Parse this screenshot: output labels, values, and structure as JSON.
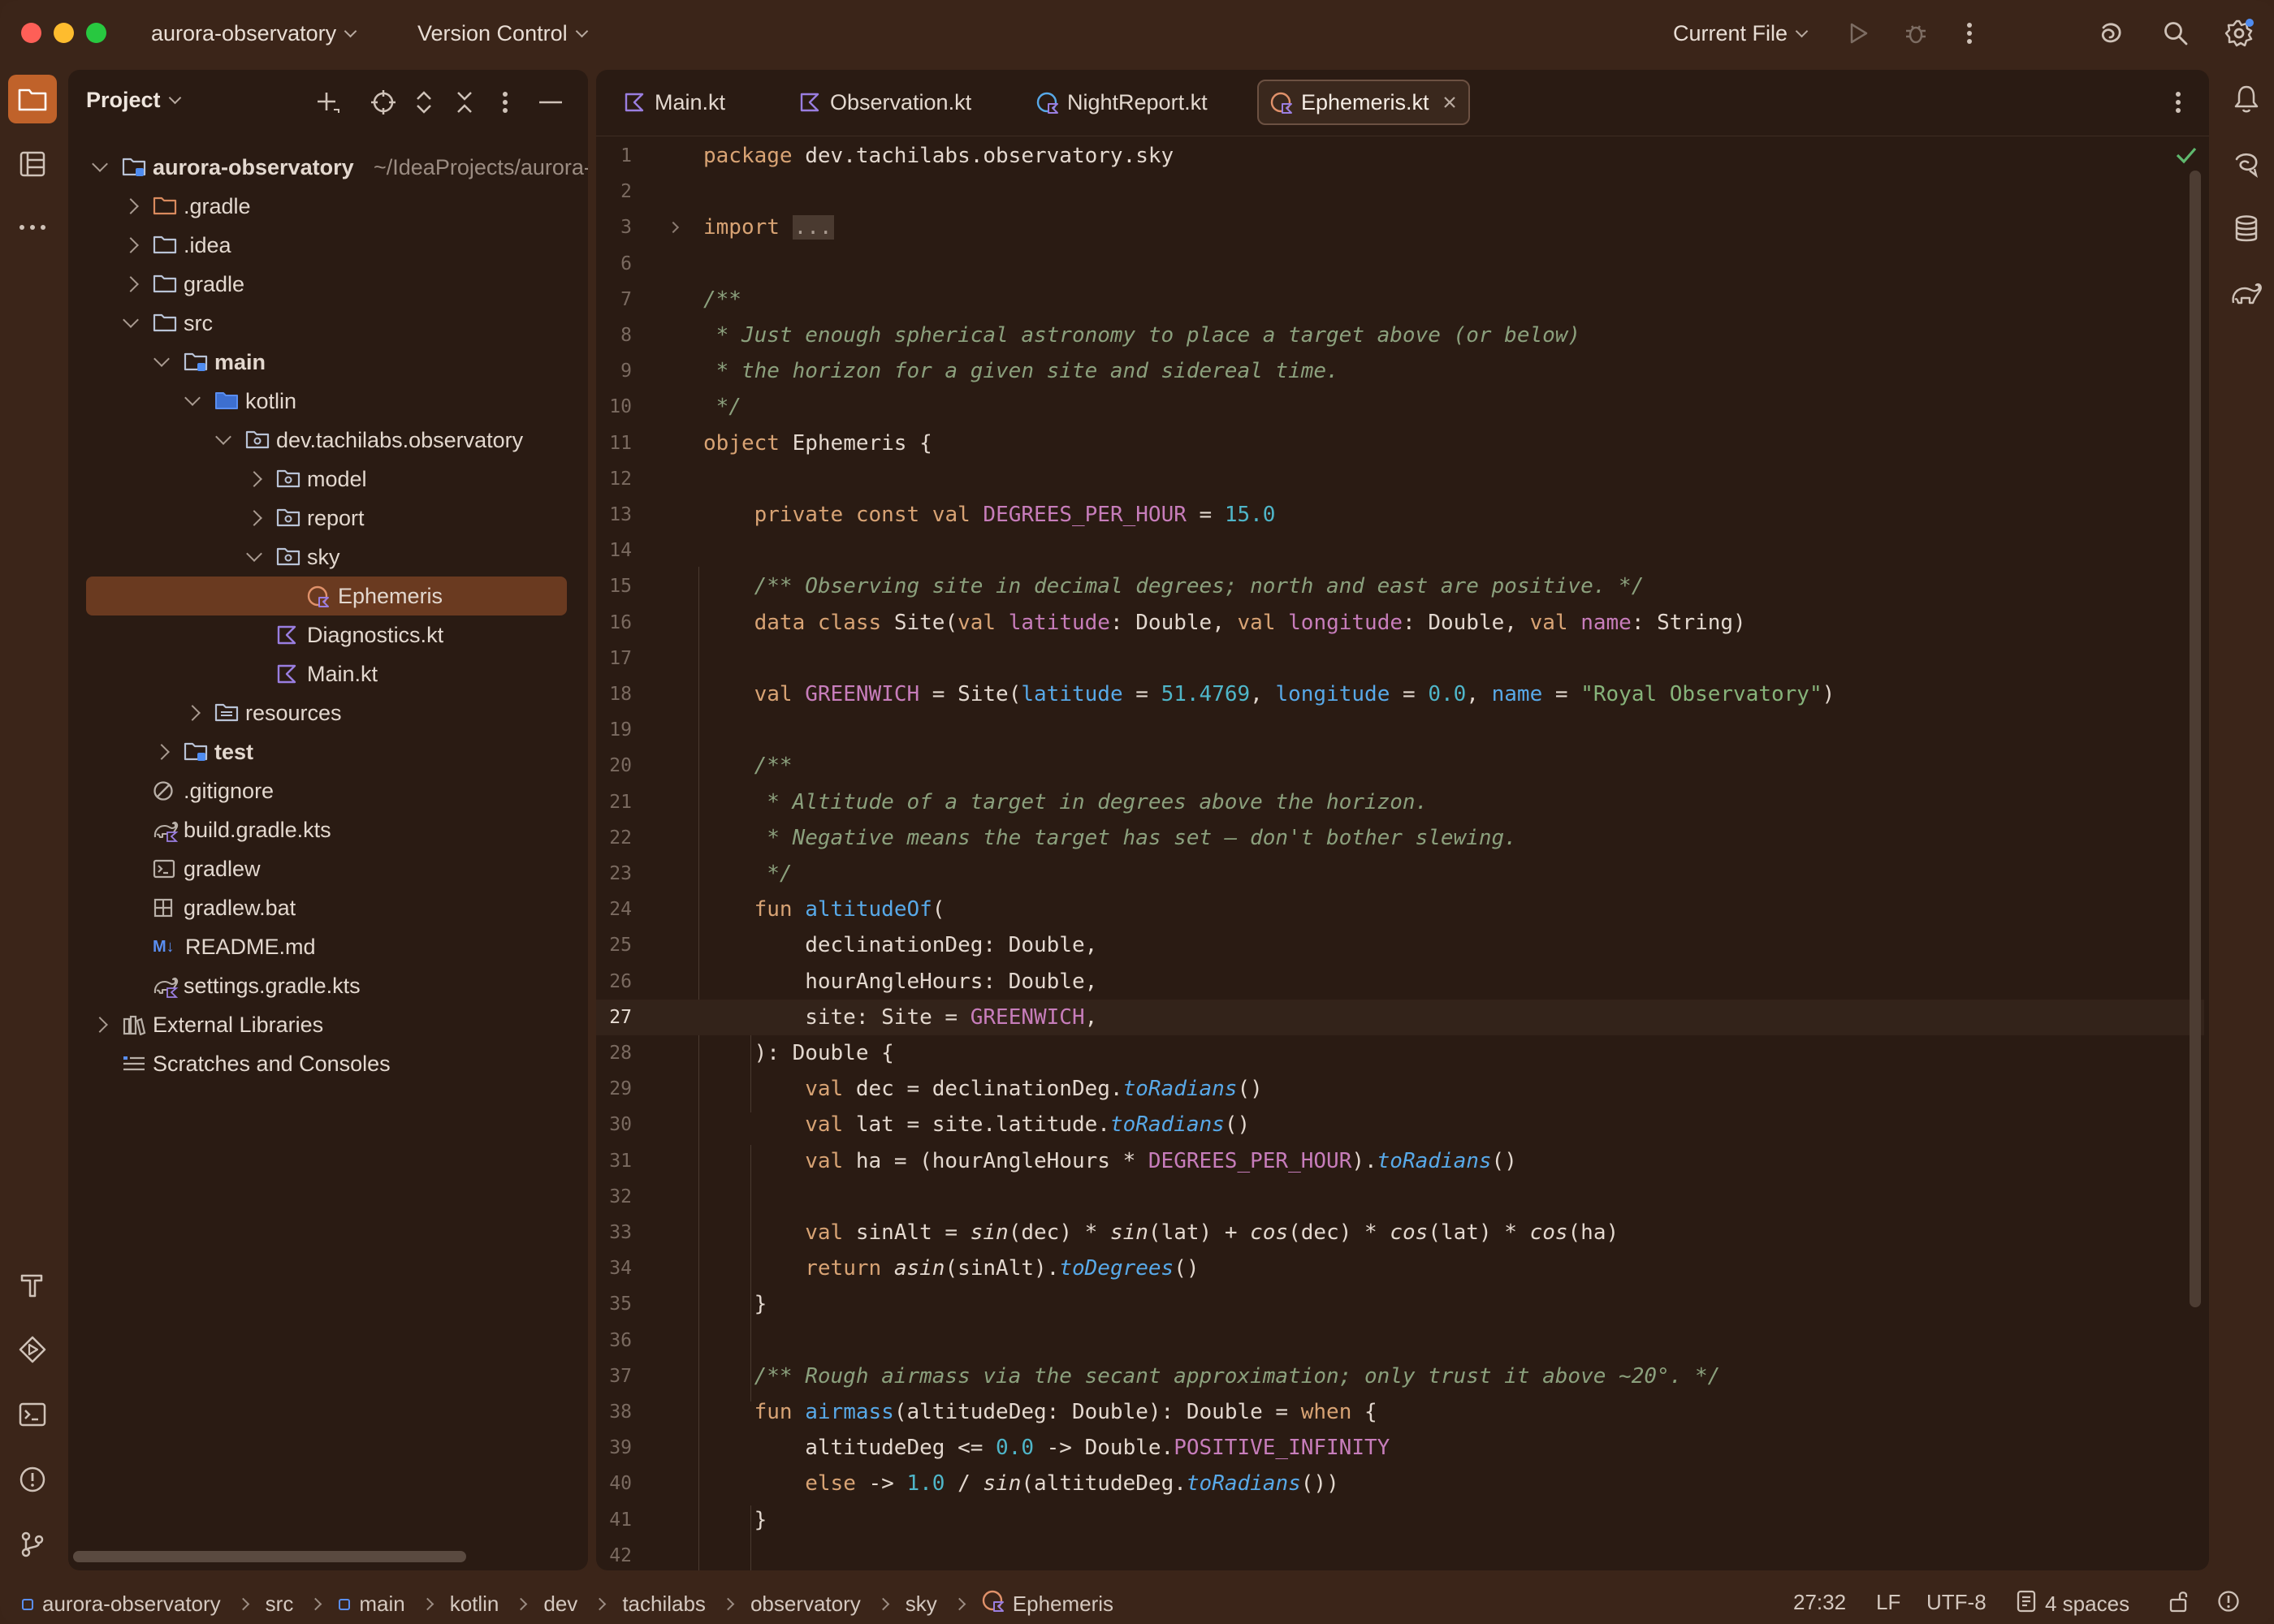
{
  "titlebar": {
    "project_name": "aurora-observatory",
    "vcs_label": "Version Control",
    "run_config": "Current File"
  },
  "project_panel": {
    "title": "Project",
    "tree": [
      {
        "label": "aurora-observatory",
        "hint": "~/IdeaProjects/aurora-",
        "icon": "module-folder-icon",
        "depth": 0,
        "expanded": true,
        "bold": true
      },
      {
        "label": ".gradle",
        "icon": "folder-orange-icon",
        "depth": 1,
        "expanded": false
      },
      {
        "label": ".idea",
        "icon": "folder-icon",
        "depth": 1,
        "expanded": false
      },
      {
        "label": "gradle",
        "icon": "folder-icon",
        "depth": 1,
        "expanded": false
      },
      {
        "label": "src",
        "icon": "folder-icon",
        "depth": 1,
        "expanded": true
      },
      {
        "label": "main",
        "icon": "source-set-folder-icon",
        "depth": 2,
        "expanded": true,
        "bold": true
      },
      {
        "label": "kotlin",
        "icon": "source-root-folder-icon",
        "depth": 3,
        "expanded": true
      },
      {
        "label": "dev.tachilabs.observatory",
        "icon": "package-icon",
        "depth": 4,
        "expanded": true
      },
      {
        "label": "model",
        "icon": "package-icon",
        "depth": 5,
        "expanded": false
      },
      {
        "label": "report",
        "icon": "package-icon",
        "depth": 5,
        "expanded": false
      },
      {
        "label": "sky",
        "icon": "package-icon",
        "depth": 5,
        "expanded": true
      },
      {
        "label": "Ephemeris",
        "icon": "kotlin-object-icon",
        "depth": 6,
        "selected": true
      },
      {
        "label": "Diagnostics.kt",
        "icon": "kotlin-file-icon",
        "depth": 5
      },
      {
        "label": "Main.kt",
        "icon": "kotlin-file-icon",
        "depth": 5
      },
      {
        "label": "resources",
        "icon": "resources-folder-icon",
        "depth": 3,
        "expanded": false
      },
      {
        "label": "test",
        "icon": "source-set-folder-icon",
        "depth": 2,
        "expanded": false,
        "bold": true
      },
      {
        "label": ".gitignore",
        "icon": "ignore-file-icon",
        "depth": 1
      },
      {
        "label": "build.gradle.kts",
        "icon": "gradle-file-icon",
        "depth": 1
      },
      {
        "label": "gradlew",
        "icon": "terminal-file-icon",
        "depth": 1
      },
      {
        "label": "gradlew.bat",
        "icon": "windows-file-icon",
        "depth": 1
      },
      {
        "label": "README.md",
        "icon": "markdown-file-icon",
        "depth": 1
      },
      {
        "label": "settings.gradle.kts",
        "icon": "gradle-file-icon",
        "depth": 1
      },
      {
        "label": "External Libraries",
        "icon": "libraries-icon",
        "depth": 0,
        "expanded": false
      },
      {
        "label": "Scratches and Consoles",
        "icon": "scratches-icon",
        "depth": 0
      }
    ]
  },
  "editor": {
    "tabs": [
      {
        "label": "Main.kt",
        "icon": "kotlin-file-icon"
      },
      {
        "label": "Observation.kt",
        "icon": "kotlin-file-icon"
      },
      {
        "label": "NightReport.kt",
        "icon": "kotlin-object-icon"
      },
      {
        "label": "Ephemeris.kt",
        "icon": "kotlin-object-icon",
        "active": true
      }
    ],
    "current_line": 27,
    "line_numbers": [
      "1",
      "2",
      "3",
      "6",
      "7",
      "8",
      "9",
      "10",
      "11",
      "12",
      "13",
      "14",
      "15",
      "16",
      "17",
      "18",
      "19",
      "20",
      "21",
      "22",
      "23",
      "24",
      "25",
      "26",
      "27",
      "28",
      "29",
      "30",
      "31",
      "32",
      "33",
      "34",
      "35",
      "36",
      "37",
      "38",
      "39",
      "40",
      "41",
      "42"
    ],
    "lines": [
      "package dev.tachilabs.observatory.sky",
      "",
      "import ...",
      "",
      "/**",
      " * Just enough spherical astronomy to place a target above (or below)",
      " * the horizon for a given site and sidereal time.",
      " */",
      "object Ephemeris {",
      "",
      "    private const val DEGREES_PER_HOUR = 15.0",
      "",
      "    /** Observing site in decimal degrees; north and east are positive. */",
      "    data class Site(val latitude: Double, val longitude: Double, val name: String)",
      "",
      "    val GREENWICH = Site(latitude = 51.4769, longitude = 0.0, name = \"Royal Observatory\")",
      "",
      "    /**",
      "     * Altitude of a target in degrees above the horizon.",
      "     * Negative means the target has set — don't bother slewing.",
      "     */",
      "    fun altitudeOf(",
      "        declinationDeg: Double,",
      "        hourAngleHours: Double,",
      "        site: Site = GREENWICH,",
      "    ): Double {",
      "        val dec = declinationDeg.toRadians()",
      "        val lat = site.latitude.toRadians()",
      "        val ha = (hourAngleHours * DEGREES_PER_HOUR).toRadians()",
      "",
      "        val sinAlt = sin(dec) * sin(lat) + cos(dec) * cos(lat) * cos(ha)",
      "        return asin(sinAlt).toDegrees()",
      "    }",
      "",
      "    /** Rough airmass via the secant approximation; only trust it above ~20°. */",
      "    fun airmass(altitudeDeg: Double): Double = when {",
      "        altitudeDeg <= 0.0 -> Double.POSITIVE_INFINITY",
      "        else -> 1.0 / sin(altitudeDeg.toRadians())",
      "    }",
      ""
    ]
  },
  "statusbar": {
    "breadcrumbs": [
      "aurora-observatory",
      "src",
      "main",
      "kotlin",
      "dev",
      "tachilabs",
      "observatory",
      "sky",
      "Ephemeris"
    ],
    "cursor_position": "27:32",
    "line_separator": "LF",
    "encoding": "UTF-8",
    "indent": "4 spaces"
  },
  "colors": {
    "accent": "#c0622a",
    "selection": "#6a3a20",
    "background": "#2a1b13",
    "chrome": "#3b2519"
  }
}
